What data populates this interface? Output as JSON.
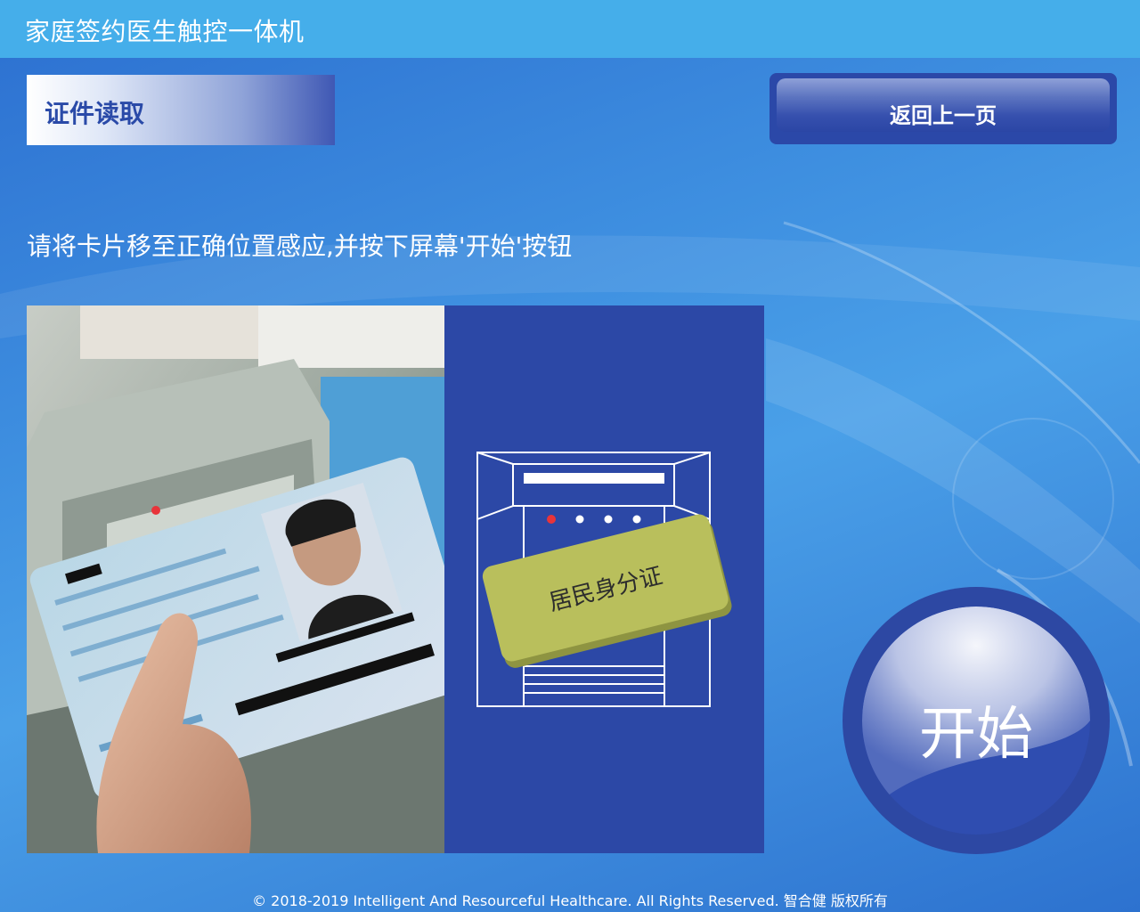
{
  "header": {
    "title": "家庭签约医生触控一体机"
  },
  "section": {
    "title": "证件读取"
  },
  "nav": {
    "back_label": "返回上一页"
  },
  "instruction": "请将卡片移至正确位置感应,并按下屏幕'开始'按钮",
  "diagram": {
    "card_label": "居民身分证"
  },
  "actions": {
    "start_label": "开始"
  },
  "footer": {
    "copyright": "© 2018-2019 Intelligent And Resourceful Healthcare. All Rights Reserved. 智合健 版权所有"
  },
  "colors": {
    "topbar": "#45aeea",
    "panel_blue": "#2c48a6",
    "card": "#b9bf5c",
    "accent_red": "#e8343a"
  }
}
